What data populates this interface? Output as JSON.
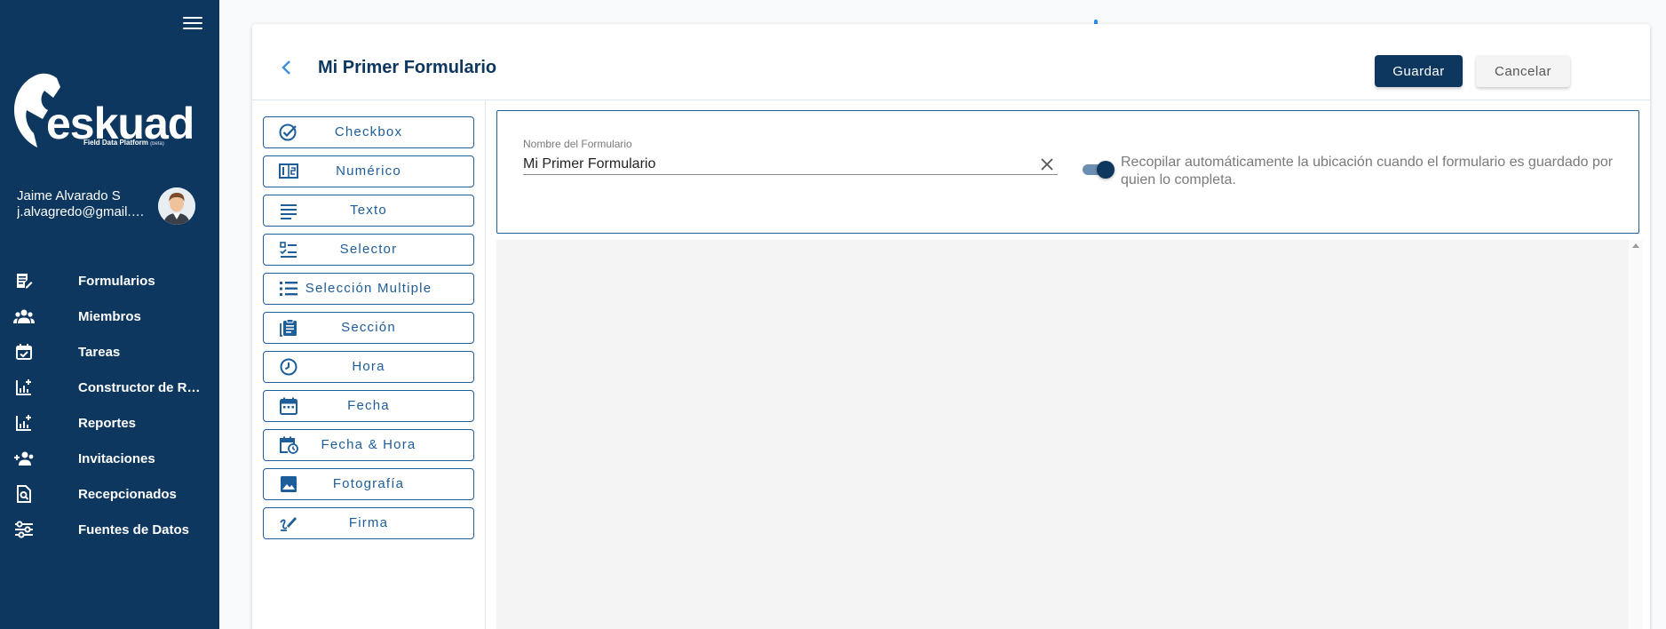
{
  "app": {
    "brand": "eskuad",
    "tagline": "Field Data Platform",
    "tagline_badge": "(beta)"
  },
  "user": {
    "name": "Jaime Alvarado S",
    "email": "j.alvagredo@gmail.com"
  },
  "sidebar": {
    "items": [
      {
        "label": "Formularios",
        "icon": "form-edit-icon"
      },
      {
        "label": "Miembros",
        "icon": "group-icon"
      },
      {
        "label": "Tareas",
        "icon": "calendar-check-icon"
      },
      {
        "label": "Constructor de Reportes",
        "icon": "chart-add-icon"
      },
      {
        "label": "Reportes",
        "icon": "chart-add-icon"
      },
      {
        "label": "Invitaciones",
        "icon": "person-add-icon"
      },
      {
        "label": "Recepcionados",
        "icon": "document-search-icon"
      },
      {
        "label": "Fuentes de Datos",
        "icon": "settings-sliders-icon"
      }
    ]
  },
  "header": {
    "title": "Mi Primer Formulario",
    "save_label": "Guardar",
    "cancel_label": "Cancelar"
  },
  "palette": {
    "items": [
      {
        "label": "Checkbox",
        "icon": "check-circle-icon"
      },
      {
        "label": "Numérico",
        "icon": "numeric-icon"
      },
      {
        "label": "Texto",
        "icon": "text-lines-icon"
      },
      {
        "label": "Selector",
        "icon": "checklist-icon"
      },
      {
        "label": "Selección Multiple",
        "icon": "list-icon"
      },
      {
        "label": "Sección",
        "icon": "clipboard-icon"
      },
      {
        "label": "Hora",
        "icon": "clock-icon"
      },
      {
        "label": "Fecha",
        "icon": "calendar-icon"
      },
      {
        "label": "Fecha & Hora",
        "icon": "calendar-clock-icon"
      },
      {
        "label": "Fotografía",
        "icon": "image-icon"
      },
      {
        "label": "Firma",
        "icon": "signature-icon"
      }
    ]
  },
  "form": {
    "name_label": "Nombre del Formulario",
    "name_value": "Mi Primer Formulario",
    "location_toggle_on": true,
    "location_toggle_text": "Recopilar automáticamente la ubicación cuando el formulario es guardado por quien lo completa."
  },
  "colors": {
    "sidebar_bg": "#0e3760",
    "accent": "#1d5d99",
    "primary_button": "#0e3760"
  }
}
